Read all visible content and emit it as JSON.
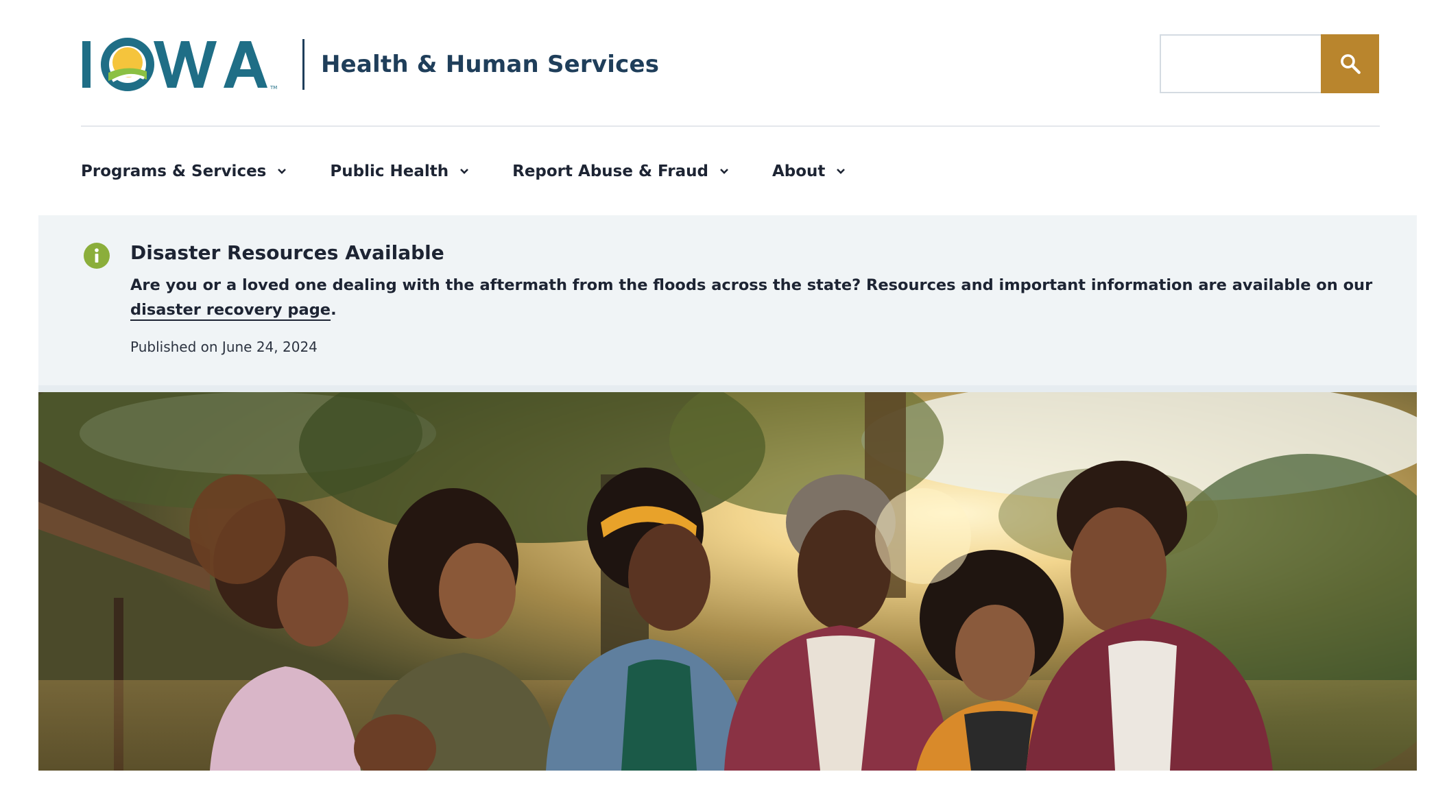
{
  "header": {
    "logo_text": "IOWA",
    "logo_subtitle": "Health & Human Services",
    "search": {
      "placeholder": "",
      "value": "",
      "button_icon": "search-icon"
    }
  },
  "nav": {
    "items": [
      {
        "label": "Programs & Services",
        "icon": "chevron-down-icon"
      },
      {
        "label": "Public Health",
        "icon": "chevron-down-icon"
      },
      {
        "label": "Report Abuse & Fraud",
        "icon": "chevron-down-icon"
      },
      {
        "label": "About",
        "icon": "chevron-down-icon"
      }
    ]
  },
  "alert": {
    "icon": "info-icon",
    "title": "Disaster Resources Available",
    "body_text": "Are you or a loved one dealing with the aftermath from the floods across the state? Resources and important information are available on our ",
    "link_text": "disaster recovery page",
    "body_end": ".",
    "published": "Published on June 24, 2024"
  },
  "hero": {
    "image": "family-group-photo"
  },
  "colors": {
    "brand_navy": "#1f3e5a",
    "logo_teal": "#1f6e86",
    "search_button": "#b9852d",
    "alert_background": "#f0f4f6",
    "info_icon": "#8bae3b",
    "sun_yellow": "#f5c43c",
    "sun_green": "#8bc043"
  }
}
